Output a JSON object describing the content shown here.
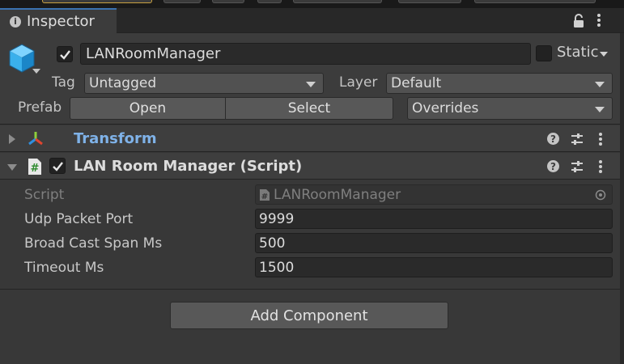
{
  "tab": {
    "title": "Inspector"
  },
  "header": {
    "object_name": "LANRoomManager",
    "active": true,
    "static_label": "Static",
    "static_checked": false,
    "tag_label": "Tag",
    "tag_value": "Untagged",
    "layer_label": "Layer",
    "layer_value": "Default",
    "prefab_label": "Prefab",
    "open_label": "Open",
    "select_label": "Select",
    "overrides_label": "Overrides"
  },
  "components": [
    {
      "title": "Transform",
      "expanded": false
    },
    {
      "title": "LAN Room Manager (Script)",
      "expanded": true,
      "enabled": true,
      "properties": [
        {
          "label": "Script",
          "value": "LANRoomManager"
        },
        {
          "label": "Udp Packet Port",
          "value": "9999"
        },
        {
          "label": "Broad Cast Span Ms",
          "value": "500"
        },
        {
          "label": "Timeout Ms",
          "value": "1500"
        }
      ]
    }
  ],
  "add_component_label": "Add Component",
  "colors": {
    "panel_bg": "#383838",
    "header_bg": "#3c3c3c",
    "field_bg": "#2a2a2a",
    "button_bg": "#585858",
    "transform_title": "#7fb2e8",
    "tab_accent": "#3a72b0"
  },
  "icons": {
    "tab": "info-icon",
    "lock": "lock-icon",
    "object": "cube-icon",
    "transform": "transform-axes-icon",
    "script": "csharp-script-icon",
    "help": "help-icon",
    "presets": "presets-icon",
    "menu": "kebab-menu-icon",
    "object_picker": "object-picker-icon"
  }
}
